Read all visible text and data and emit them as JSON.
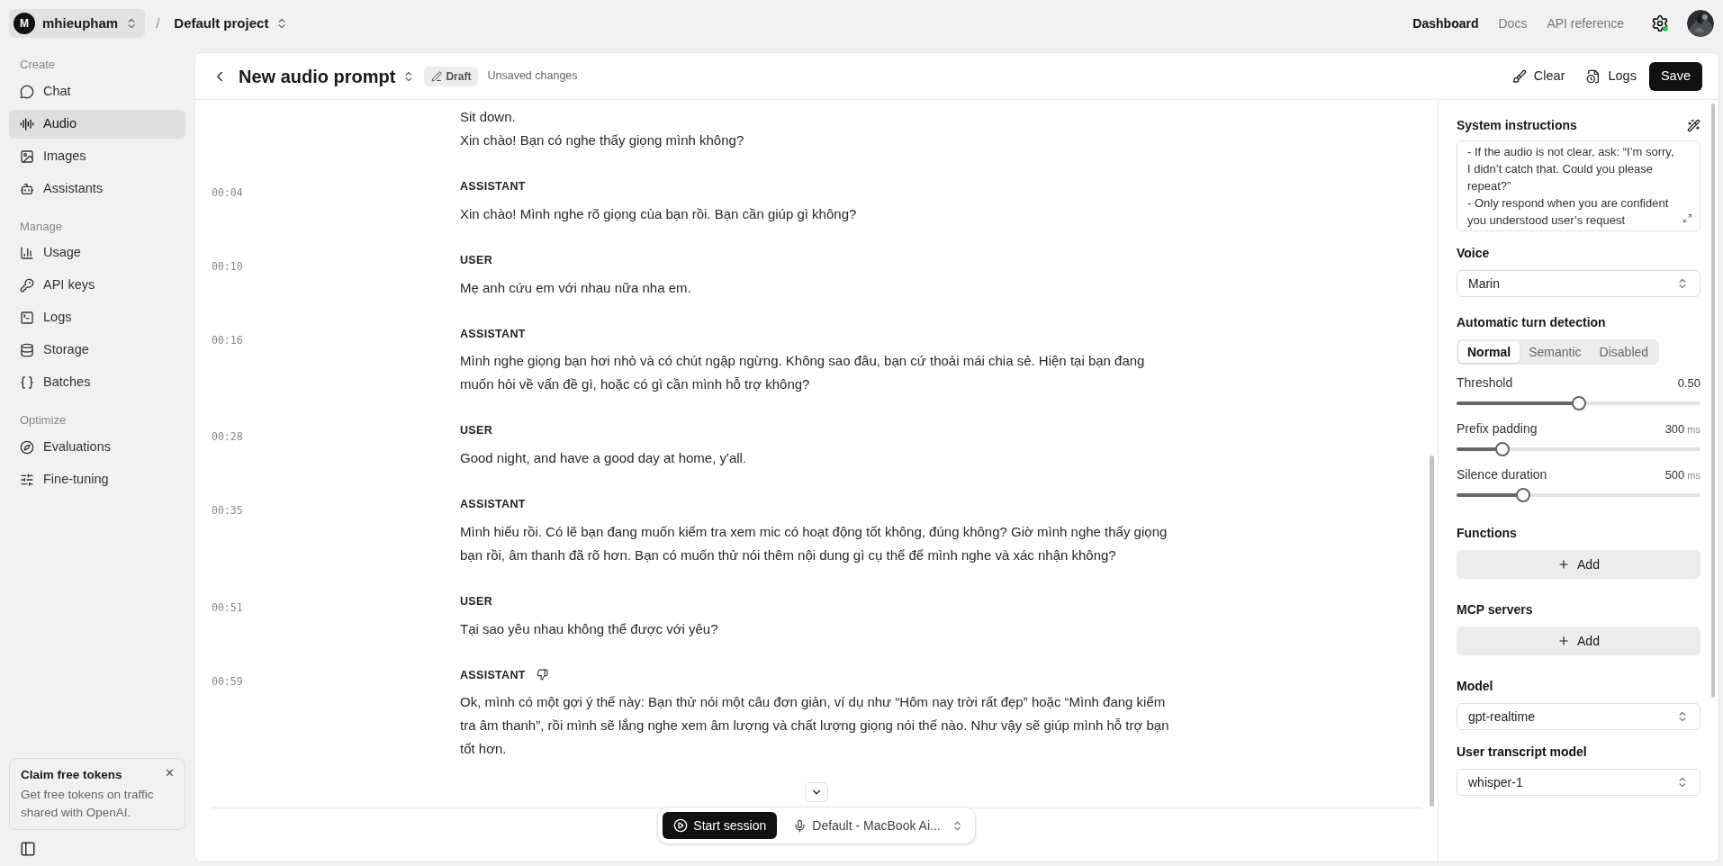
{
  "topbar": {
    "account": {
      "initial": "M",
      "name": "mhieupham"
    },
    "separator": "/",
    "project": "Default project",
    "links": [
      {
        "label": "Dashboard",
        "selected": true
      },
      {
        "label": "Docs",
        "selected": false
      },
      {
        "label": "API reference",
        "selected": false
      }
    ]
  },
  "sidebar": {
    "sections": [
      {
        "title": "Create",
        "items": [
          {
            "label": "Chat",
            "selected": false
          },
          {
            "label": "Audio",
            "selected": true
          },
          {
            "label": "Images",
            "selected": false
          },
          {
            "label": "Assistants",
            "selected": false
          }
        ]
      },
      {
        "title": "Manage",
        "items": [
          {
            "label": "Usage",
            "selected": false
          },
          {
            "label": "API keys",
            "selected": false
          },
          {
            "label": "Logs",
            "selected": false
          },
          {
            "label": "Storage",
            "selected": false
          },
          {
            "label": "Batches",
            "selected": false
          }
        ]
      },
      {
        "title": "Optimize",
        "items": [
          {
            "label": "Evaluations",
            "selected": false
          },
          {
            "label": "Fine-tuning",
            "selected": false
          }
        ]
      }
    ],
    "promo": {
      "title": "Claim free tokens",
      "close": "×",
      "text": "Get free tokens on traffic shared with OpenAI."
    }
  },
  "header": {
    "title": "New audio prompt",
    "badge": "Draft",
    "status": "Unsaved changes",
    "actions": [
      {
        "label": "Clear"
      },
      {
        "label": "Logs"
      }
    ],
    "save": "Save"
  },
  "transcript": {
    "messages": [
      {
        "paragraphs": [
          "Sit down.",
          "Xin chào! Bạn có nghe thấy giọng mình không?"
        ]
      },
      {
        "time": "00:04",
        "role": "ASSISTANT",
        "feedback": false,
        "paragraphs": [
          "Xin chào! Mình nghe rõ giọng của bạn rồi. Bạn cần giúp gì không?"
        ]
      },
      {
        "time": "00:10",
        "role": "USER",
        "feedback": false,
        "paragraphs": [
          "Mẹ anh cứu em với nhau nữa nha em."
        ]
      },
      {
        "time": "00:16",
        "role": "ASSISTANT",
        "feedback": false,
        "paragraphs": [
          "Mình nghe giọng bạn hơi nhỏ và có chút ngập ngừng. Không sao đâu, bạn cứ thoải mái chia sẻ. Hiện tại bạn đang muốn hỏi về vấn đề gì, hoặc có gì cần mình hỗ trợ không?"
        ]
      },
      {
        "time": "00:28",
        "role": "USER",
        "feedback": false,
        "paragraphs": [
          "Good night, and have a good day at home, y'all."
        ]
      },
      {
        "time": "00:35",
        "role": "ASSISTANT",
        "feedback": false,
        "paragraphs": [
          "Mình hiểu rồi. Có lẽ bạn đang muốn kiểm tra xem mic có hoạt động tốt không, đúng không? Giờ mình nghe thấy giọng bạn rồi, âm thanh đã rõ hơn. Bạn có muốn thử nói thêm nội dung gì cụ thể để mình nghe và xác nhận không?"
        ]
      },
      {
        "time": "00:51",
        "role": "USER",
        "feedback": false,
        "paragraphs": [
          "Tại sao yêu nhau không thể được với yêu?"
        ]
      },
      {
        "time": "00:59",
        "role": "ASSISTANT",
        "feedback": true,
        "paragraphs": [
          "Ok, mình có một gợi ý thế này: Bạn thử nói một câu đơn giản, ví dụ như “Hôm nay trời rất đẹp” hoặc “Mình đang kiểm tra âm thanh”, rồi mình sẽ lắng nghe xem âm lượng và chất lượng giọng nói thế nào. Như vậy sẽ giúp mình hỗ trợ bạn tốt hơn."
        ]
      }
    ],
    "session": {
      "start": "Start session",
      "device": "Default - MacBook Ai..."
    }
  },
  "settings": {
    "system_instructions": {
      "label": "System instructions",
      "text": "- If the audio is not clear, ask: “I’m sorry, I didn’t catch that. Could you please repeat?”\n- Only respond when you are confident you understood user’s request"
    },
    "voice": {
      "label": "Voice",
      "value": "Marin"
    },
    "turn_detection": {
      "label": "Automatic turn detection",
      "modes": [
        {
          "label": "Normal",
          "selected": true
        },
        {
          "label": "Semantic",
          "selected": false
        },
        {
          "label": "Disabled",
          "selected": false
        }
      ],
      "sliders": [
        {
          "label": "Threshold",
          "value": "0.50",
          "level": 0.5
        },
        {
          "label": "Prefix padding",
          "value": "300",
          "unit": "ms",
          "level": 0.17
        },
        {
          "label": "Silence duration",
          "value": "500",
          "unit": "ms",
          "level": 0.26
        }
      ]
    },
    "functions": {
      "label": "Functions",
      "add": "Add"
    },
    "mcp_servers": {
      "label": "MCP servers",
      "add": "Add"
    },
    "model": {
      "label": "Model",
      "value": "gpt-realtime"
    },
    "transcript_model": {
      "label": "User transcript model",
      "value": "whisper-1"
    }
  }
}
